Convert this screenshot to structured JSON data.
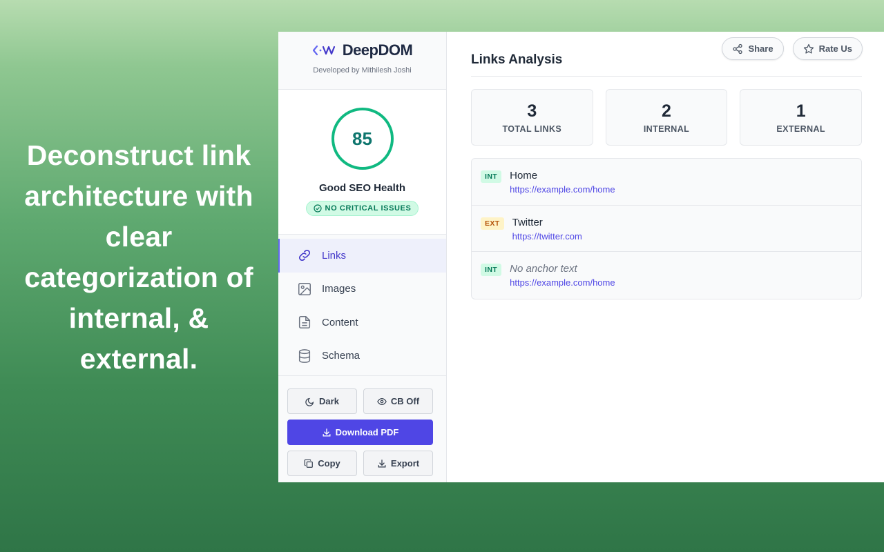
{
  "tagline": "Deconstruct link architecture with clear categorization of internal, & external.",
  "brand": {
    "name": "DeepDOM",
    "subtitle": "Developed by Mithilesh Joshi"
  },
  "health": {
    "score": "85",
    "label": "Good SEO Health",
    "badge": "NO CRITICAL ISSUES"
  },
  "nav": [
    {
      "label": "Links",
      "icon": "link-icon",
      "active": true
    },
    {
      "label": "Images",
      "icon": "image-icon",
      "active": false
    },
    {
      "label": "Content",
      "icon": "document-icon",
      "active": false
    },
    {
      "label": "Schema",
      "icon": "database-icon",
      "active": false
    }
  ],
  "buttons": {
    "dark": "Dark",
    "cb": "CB Off",
    "download": "Download PDF",
    "copy": "Copy",
    "export": "Export"
  },
  "top_actions": {
    "share": "Share",
    "rate": "Rate Us"
  },
  "main": {
    "title": "Links Analysis",
    "stats": [
      {
        "value": "3",
        "label": "TOTAL LINKS"
      },
      {
        "value": "2",
        "label": "INTERNAL"
      },
      {
        "value": "1",
        "label": "EXTERNAL"
      }
    ],
    "links": [
      {
        "tag": "INT",
        "text": "Home",
        "url": "https://example.com/home"
      },
      {
        "tag": "EXT",
        "text": "Twitter",
        "url": "https://twitter.com"
      },
      {
        "tag": "INT",
        "text": "No anchor text",
        "url": "https://example.com/home"
      }
    ]
  },
  "colors": {
    "accent": "#4f46e5",
    "success": "#10b981",
    "warning": "#b45309"
  }
}
